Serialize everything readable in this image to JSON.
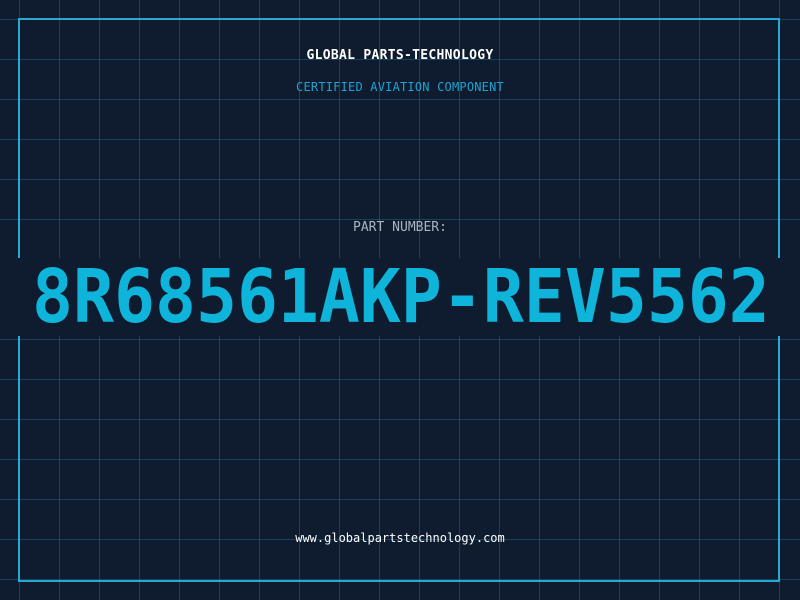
{
  "header": {
    "company_name": "GLOBAL PARTS-TECHNOLOGY",
    "tagline": "CERTIFIED AVIATION COMPONENT"
  },
  "part": {
    "label": "PART NUMBER:",
    "number": "8R68561AKP-REV5562"
  },
  "footer": {
    "website": "www.globalpartstechnology.com"
  },
  "colors": {
    "background": "#0f1b2e",
    "grid": "#2896be",
    "frame": "#27a9d2",
    "accent": "#0fb4db",
    "label": "#a9b4c4",
    "text": "#ffffff"
  }
}
